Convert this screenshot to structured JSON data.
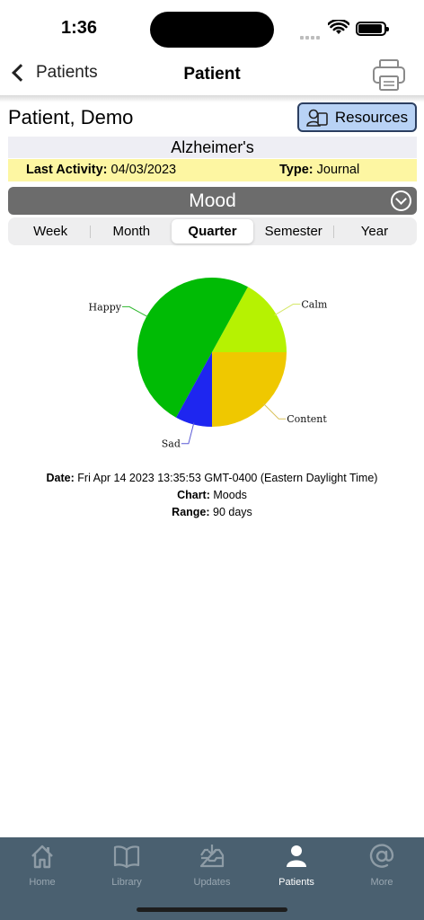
{
  "status": {
    "time": "1:36"
  },
  "nav": {
    "back_label": "Patients",
    "title": "Patient",
    "print_icon": "printer-icon"
  },
  "patient": {
    "name": "Patient, Demo",
    "resources_label": "Resources",
    "condition": "Alzheimer's",
    "last_activity_label": "Last Activity:",
    "last_activity_value": "04/03/2023",
    "type_label": "Type:",
    "type_value": "Journal"
  },
  "mood": {
    "title": "Mood"
  },
  "periods": {
    "items": [
      "Week",
      "Month",
      "Quarter",
      "Semester",
      "Year"
    ],
    "selected": "Quarter"
  },
  "chart_data": {
    "type": "pie",
    "categories": [
      "Calm",
      "Happy",
      "Sad",
      "Content"
    ],
    "values": [
      17,
      50,
      8,
      25
    ],
    "colors": [
      "#b6f202",
      "#00bb05",
      "#1e26f0",
      "#efc800"
    ],
    "leader_colors": [
      "#d6e86a",
      "#2eb82e",
      "#5a5ad6",
      "#d9c15a"
    ]
  },
  "meta": {
    "date_label": "Date:",
    "date_value": "Fri Apr 14 2023 13:35:53 GMT-0400 (Eastern Daylight Time)",
    "chart_label": "Chart:",
    "chart_value": "Moods",
    "range_label": "Range:",
    "range_value": "90 days"
  },
  "tabs": [
    {
      "label": "Home",
      "icon": "home-icon"
    },
    {
      "label": "Library",
      "icon": "book-icon"
    },
    {
      "label": "Updates",
      "icon": "inbox-icon"
    },
    {
      "label": "Patients",
      "icon": "person-icon"
    },
    {
      "label": "More",
      "icon": "at-icon"
    }
  ],
  "active_tab": "Patients"
}
